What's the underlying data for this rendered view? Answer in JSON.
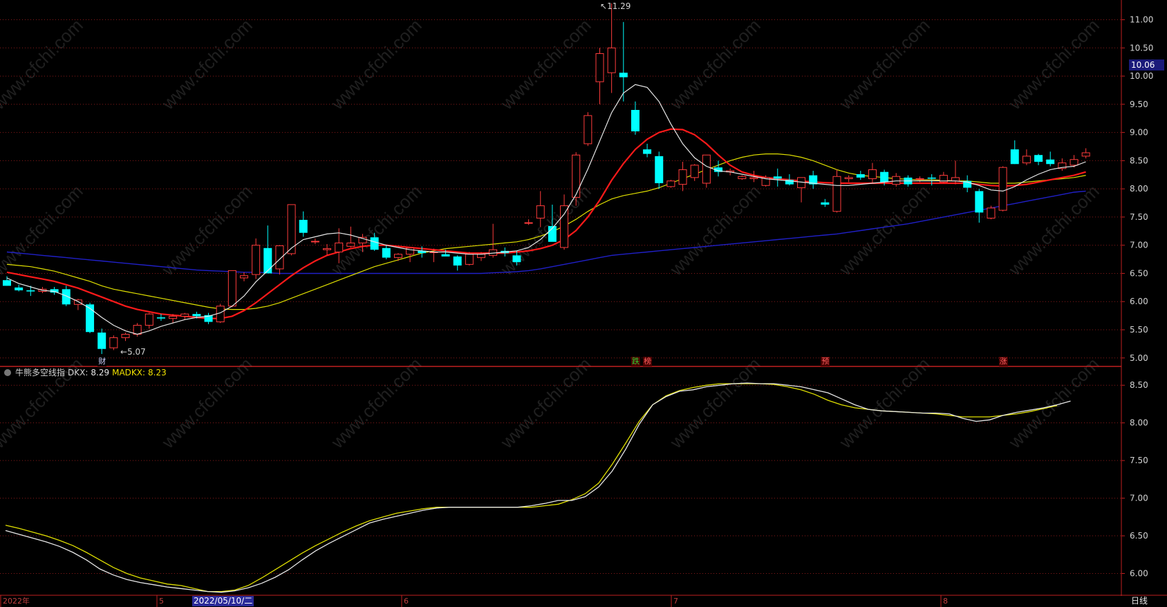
{
  "chart_data": {
    "type": "candlestick",
    "upper_panel": {
      "y_ticks": [
        "11.00",
        "10.50",
        "10.00",
        "9.50",
        "9.00",
        "8.50",
        "8.00",
        "7.50",
        "7.00",
        "6.50",
        "6.00",
        "5.50",
        "5.00"
      ],
      "ylim": [
        4.85,
        11.35
      ],
      "current_price": "10.06",
      "high_mark": "11.29",
      "low_mark": "5.07",
      "candles": [
        {
          "o": 6.38,
          "h": 6.45,
          "l": 6.28,
          "c": 6.28
        },
        {
          "o": 6.25,
          "h": 6.3,
          "l": 6.18,
          "c": 6.2
        },
        {
          "o": 6.2,
          "h": 6.28,
          "l": 6.1,
          "c": 6.18
        },
        {
          "o": 6.18,
          "h": 6.26,
          "l": 6.15,
          "c": 6.22
        },
        {
          "o": 6.22,
          "h": 6.26,
          "l": 6.12,
          "c": 6.16
        },
        {
          "o": 6.22,
          "h": 6.28,
          "l": 5.92,
          "c": 5.95
        },
        {
          "o": 5.95,
          "h": 6.05,
          "l": 5.85,
          "c": 6.03
        },
        {
          "o": 5.95,
          "h": 5.98,
          "l": 5.44,
          "c": 5.46
        },
        {
          "o": 5.45,
          "h": 5.52,
          "l": 5.07,
          "c": 5.16
        },
        {
          "o": 5.18,
          "h": 5.4,
          "l": 5.14,
          "c": 5.36
        },
        {
          "o": 5.36,
          "h": 5.45,
          "l": 5.3,
          "c": 5.42
        },
        {
          "o": 5.42,
          "h": 5.62,
          "l": 5.38,
          "c": 5.58
        },
        {
          "o": 5.58,
          "h": 5.8,
          "l": 5.52,
          "c": 5.78
        },
        {
          "o": 5.72,
          "h": 5.78,
          "l": 5.66,
          "c": 5.7
        },
        {
          "o": 5.7,
          "h": 5.78,
          "l": 5.62,
          "c": 5.74
        },
        {
          "o": 5.74,
          "h": 5.8,
          "l": 5.68,
          "c": 5.78
        },
        {
          "o": 5.78,
          "h": 5.82,
          "l": 5.7,
          "c": 5.74
        },
        {
          "o": 5.76,
          "h": 5.8,
          "l": 5.6,
          "c": 5.64
        },
        {
          "o": 5.64,
          "h": 5.96,
          "l": 5.62,
          "c": 5.92
        },
        {
          "o": 5.92,
          "h": 6.55,
          "l": 5.9,
          "c": 6.55
        },
        {
          "o": 6.42,
          "h": 6.52,
          "l": 6.36,
          "c": 6.46
        },
        {
          "o": 6.48,
          "h": 7.12,
          "l": 6.4,
          "c": 7.0
        },
        {
          "o": 6.95,
          "h": 7.35,
          "l": 6.75,
          "c": 6.5
        },
        {
          "o": 6.58,
          "h": 7.0,
          "l": 6.48,
          "c": 6.99
        },
        {
          "o": 6.85,
          "h": 7.72,
          "l": 6.82,
          "c": 7.72
        },
        {
          "o": 7.45,
          "h": 7.6,
          "l": 7.15,
          "c": 7.22
        },
        {
          "o": 7.07,
          "h": 7.12,
          "l": 7.02,
          "c": 7.07
        },
        {
          "o": 6.92,
          "h": 7.02,
          "l": 6.82,
          "c": 6.94
        },
        {
          "o": 6.88,
          "h": 7.3,
          "l": 6.68,
          "c": 7.04
        },
        {
          "o": 6.98,
          "h": 7.33,
          "l": 6.96,
          "c": 7.04
        },
        {
          "o": 7.04,
          "h": 7.2,
          "l": 6.88,
          "c": 7.14
        },
        {
          "o": 7.14,
          "h": 7.22,
          "l": 6.9,
          "c": 6.92
        },
        {
          "o": 6.95,
          "h": 7.0,
          "l": 6.75,
          "c": 6.78
        },
        {
          "o": 6.78,
          "h": 6.86,
          "l": 6.72,
          "c": 6.84
        },
        {
          "o": 6.84,
          "h": 6.95,
          "l": 6.7,
          "c": 6.95
        },
        {
          "o": 6.9,
          "h": 6.98,
          "l": 6.78,
          "c": 6.86
        },
        {
          "o": 6.88,
          "h": 6.94,
          "l": 6.7,
          "c": 6.88
        },
        {
          "o": 6.84,
          "h": 6.92,
          "l": 6.8,
          "c": 6.8
        },
        {
          "o": 6.8,
          "h": 6.82,
          "l": 6.55,
          "c": 6.64
        },
        {
          "o": 6.66,
          "h": 6.88,
          "l": 6.64,
          "c": 6.84
        },
        {
          "o": 6.78,
          "h": 6.88,
          "l": 6.72,
          "c": 6.84
        },
        {
          "o": 6.82,
          "h": 7.38,
          "l": 6.78,
          "c": 6.92
        },
        {
          "o": 6.9,
          "h": 6.96,
          "l": 6.8,
          "c": 6.86
        },
        {
          "o": 6.82,
          "h": 6.9,
          "l": 6.64,
          "c": 6.7
        },
        {
          "o": 7.4,
          "h": 7.46,
          "l": 7.36,
          "c": 7.4
        },
        {
          "o": 7.48,
          "h": 7.96,
          "l": 7.32,
          "c": 7.7
        },
        {
          "o": 7.34,
          "h": 7.72,
          "l": 7.2,
          "c": 7.06
        },
        {
          "o": 6.96,
          "h": 7.9,
          "l": 6.92,
          "c": 7.7
        },
        {
          "o": 7.85,
          "h": 8.65,
          "l": 7.7,
          "c": 8.6
        },
        {
          "o": 8.8,
          "h": 9.36,
          "l": 8.76,
          "c": 9.3
        },
        {
          "o": 9.9,
          "h": 10.5,
          "l": 9.5,
          "c": 10.4
        },
        {
          "o": 10.06,
          "h": 11.29,
          "l": 9.7,
          "c": 10.5
        },
        {
          "o": 10.06,
          "h": 10.96,
          "l": 9.55,
          "c": 9.98
        },
        {
          "o": 9.4,
          "h": 9.55,
          "l": 8.96,
          "c": 9.02
        },
        {
          "o": 8.7,
          "h": 8.8,
          "l": 8.56,
          "c": 8.62
        },
        {
          "o": 8.58,
          "h": 8.66,
          "l": 8.0,
          "c": 8.1
        },
        {
          "o": 8.04,
          "h": 8.16,
          "l": 8.02,
          "c": 8.14
        },
        {
          "o": 8.08,
          "h": 8.48,
          "l": 7.96,
          "c": 8.34
        },
        {
          "o": 8.2,
          "h": 8.44,
          "l": 8.14,
          "c": 8.42
        },
        {
          "o": 8.1,
          "h": 8.6,
          "l": 8.02,
          "c": 8.6
        },
        {
          "o": 8.38,
          "h": 8.5,
          "l": 8.22,
          "c": 8.3
        },
        {
          "o": 8.3,
          "h": 8.36,
          "l": 8.24,
          "c": 8.32
        },
        {
          "o": 8.18,
          "h": 8.24,
          "l": 8.16,
          "c": 8.22
        },
        {
          "o": 8.18,
          "h": 8.32,
          "l": 8.12,
          "c": 8.2
        },
        {
          "o": 8.06,
          "h": 8.24,
          "l": 8.04,
          "c": 8.2
        },
        {
          "o": 8.22,
          "h": 8.36,
          "l": 8.04,
          "c": 8.18
        },
        {
          "o": 8.16,
          "h": 8.26,
          "l": 8.06,
          "c": 8.08
        },
        {
          "o": 8.02,
          "h": 8.2,
          "l": 7.76,
          "c": 8.2
        },
        {
          "o": 8.24,
          "h": 8.32,
          "l": 8.0,
          "c": 8.08
        },
        {
          "o": 7.76,
          "h": 7.82,
          "l": 7.68,
          "c": 7.72
        },
        {
          "o": 7.6,
          "h": 8.34,
          "l": 7.58,
          "c": 8.22
        },
        {
          "o": 8.18,
          "h": 8.24,
          "l": 8.12,
          "c": 8.2
        },
        {
          "o": 8.26,
          "h": 8.32,
          "l": 8.16,
          "c": 8.2
        },
        {
          "o": 8.18,
          "h": 8.46,
          "l": 8.1,
          "c": 8.34
        },
        {
          "o": 8.3,
          "h": 8.34,
          "l": 8.06,
          "c": 8.12
        },
        {
          "o": 8.08,
          "h": 8.28,
          "l": 8.04,
          "c": 8.22
        },
        {
          "o": 8.2,
          "h": 8.24,
          "l": 8.04,
          "c": 8.08
        },
        {
          "o": 8.18,
          "h": 8.22,
          "l": 8.12,
          "c": 8.18
        },
        {
          "o": 8.2,
          "h": 8.26,
          "l": 8.06,
          "c": 8.18
        },
        {
          "o": 8.12,
          "h": 8.3,
          "l": 8.1,
          "c": 8.24
        },
        {
          "o": 8.14,
          "h": 8.5,
          "l": 8.08,
          "c": 8.2
        },
        {
          "o": 8.14,
          "h": 8.24,
          "l": 7.94,
          "c": 8.02
        },
        {
          "o": 7.96,
          "h": 8.0,
          "l": 7.4,
          "c": 7.58
        },
        {
          "o": 7.48,
          "h": 7.7,
          "l": 7.46,
          "c": 7.66
        },
        {
          "o": 7.62,
          "h": 8.4,
          "l": 7.6,
          "c": 8.38
        },
        {
          "o": 8.7,
          "h": 8.86,
          "l": 8.44,
          "c": 8.44
        },
        {
          "o": 8.46,
          "h": 8.7,
          "l": 8.42,
          "c": 8.58
        },
        {
          "o": 8.6,
          "h": 8.62,
          "l": 8.42,
          "c": 8.48
        },
        {
          "o": 8.52,
          "h": 8.66,
          "l": 8.4,
          "c": 8.44
        },
        {
          "o": 8.36,
          "h": 8.54,
          "l": 8.32,
          "c": 8.46
        },
        {
          "o": 8.42,
          "h": 8.6,
          "l": 8.38,
          "c": 8.52
        },
        {
          "o": 8.58,
          "h": 8.72,
          "l": 8.54,
          "c": 8.64
        }
      ],
      "ma_white": [
        6.42,
        6.32,
        6.26,
        6.2,
        6.18,
        6.1,
        6.0,
        5.88,
        5.72,
        5.58,
        5.48,
        5.42,
        5.48,
        5.56,
        5.62,
        5.68,
        5.72,
        5.74,
        5.8,
        5.92,
        6.1,
        6.35,
        6.55,
        6.75,
        6.95,
        7.1,
        7.15,
        7.2,
        7.22,
        7.18,
        7.12,
        7.06,
        7.0,
        6.96,
        6.92,
        6.9,
        6.88,
        6.88,
        6.86,
        6.84,
        6.84,
        6.86,
        6.88,
        6.9,
        6.96,
        7.1,
        7.3,
        7.55,
        7.9,
        8.35,
        8.85,
        9.35,
        9.7,
        9.85,
        9.8,
        9.55,
        9.15,
        8.8,
        8.55,
        8.4,
        8.32,
        8.3,
        8.26,
        8.22,
        8.18,
        8.16,
        8.14,
        8.12,
        8.1,
        8.08,
        8.06,
        8.06,
        8.08,
        8.1,
        8.12,
        8.14,
        8.14,
        8.14,
        8.14,
        8.14,
        8.14,
        8.12,
        8.06,
        7.98,
        7.96,
        8.04,
        8.16,
        8.26,
        8.34,
        8.38,
        8.4,
        8.48
      ],
      "ma_red": [
        6.52,
        6.48,
        6.44,
        6.4,
        6.36,
        6.3,
        6.24,
        6.16,
        6.08,
        6.0,
        5.92,
        5.86,
        5.82,
        5.78,
        5.76,
        5.74,
        5.72,
        5.7,
        5.7,
        5.74,
        5.84,
        5.98,
        6.14,
        6.3,
        6.46,
        6.6,
        6.72,
        6.82,
        6.88,
        6.94,
        6.98,
        7.0,
        7.0,
        6.98,
        6.96,
        6.94,
        6.92,
        6.9,
        6.88,
        6.86,
        6.86,
        6.86,
        6.86,
        6.88,
        6.9,
        6.94,
        7.0,
        7.1,
        7.26,
        7.5,
        7.8,
        8.15,
        8.45,
        8.7,
        8.88,
        9.0,
        9.06,
        9.05,
        8.96,
        8.8,
        8.6,
        8.42,
        8.3,
        8.24,
        8.2,
        8.18,
        8.16,
        8.14,
        8.12,
        8.11,
        8.1,
        8.1,
        8.1,
        8.1,
        8.1,
        8.1,
        8.1,
        8.1,
        8.1,
        8.1,
        8.1,
        8.1,
        8.08,
        8.06,
        8.05,
        8.06,
        8.08,
        8.12,
        8.16,
        8.2,
        8.24,
        8.3
      ],
      "ma_yellow": [
        6.66,
        6.64,
        6.62,
        6.58,
        6.54,
        6.48,
        6.42,
        6.36,
        6.28,
        6.22,
        6.18,
        6.14,
        6.1,
        6.06,
        6.02,
        5.98,
        5.94,
        5.9,
        5.87,
        5.86,
        5.86,
        5.88,
        5.92,
        5.98,
        6.06,
        6.14,
        6.22,
        6.3,
        6.38,
        6.46,
        6.54,
        6.62,
        6.68,
        6.74,
        6.8,
        6.86,
        6.9,
        6.94,
        6.96,
        6.98,
        7.0,
        7.02,
        7.04,
        7.06,
        7.1,
        7.16,
        7.24,
        7.34,
        7.46,
        7.6,
        7.72,
        7.82,
        7.88,
        7.92,
        7.96,
        8.02,
        8.1,
        8.18,
        8.26,
        8.34,
        8.42,
        8.5,
        8.56,
        8.6,
        8.62,
        8.62,
        8.6,
        8.56,
        8.5,
        8.42,
        8.34,
        8.28,
        8.24,
        8.22,
        8.2,
        8.18,
        8.17,
        8.16,
        8.16,
        8.15,
        8.14,
        8.14,
        8.12,
        8.1,
        8.1,
        8.1,
        8.12,
        8.14,
        8.16,
        8.18,
        8.2,
        8.24
      ],
      "ma_blue": [
        6.88,
        6.86,
        6.84,
        6.82,
        6.8,
        6.78,
        6.76,
        6.74,
        6.72,
        6.7,
        6.68,
        6.66,
        6.64,
        6.62,
        6.6,
        6.58,
        6.56,
        6.55,
        6.54,
        6.53,
        6.52,
        6.52,
        6.51,
        6.5,
        6.5,
        6.5,
        6.5,
        6.5,
        6.5,
        6.5,
        6.5,
        6.5,
        6.5,
        6.5,
        6.5,
        6.5,
        6.5,
        6.5,
        6.5,
        6.5,
        6.5,
        6.51,
        6.52,
        6.53,
        6.55,
        6.58,
        6.62,
        6.66,
        6.7,
        6.74,
        6.78,
        6.82,
        6.84,
        6.86,
        6.88,
        6.9,
        6.92,
        6.94,
        6.96,
        6.98,
        7.0,
        7.02,
        7.04,
        7.06,
        7.08,
        7.1,
        7.12,
        7.14,
        7.16,
        7.18,
        7.2,
        7.23,
        7.26,
        7.29,
        7.32,
        7.35,
        7.38,
        7.42,
        7.46,
        7.5,
        7.54,
        7.58,
        7.62,
        7.66,
        7.7,
        7.74,
        7.78,
        7.82,
        7.86,
        7.9,
        7.94,
        7.96
      ]
    },
    "lower_panel": {
      "indicator_name": "牛熊多空线指",
      "dkx_label": "DKX:",
      "dkx_value": "8.29",
      "madkx_label": "MADKX:",
      "madkx_value": "8.23",
      "y_ticks": [
        "8.50",
        "8.00",
        "7.50",
        "7.00",
        "6.50",
        "6.00"
      ],
      "ylim": [
        5.72,
        8.75
      ],
      "dkx": [
        6.57,
        6.52,
        6.47,
        6.42,
        6.36,
        6.28,
        6.18,
        6.06,
        5.98,
        5.92,
        5.88,
        5.85,
        5.82,
        5.8,
        5.78,
        5.76,
        5.75,
        5.77,
        5.81,
        5.87,
        5.95,
        6.05,
        6.18,
        6.3,
        6.4,
        6.49,
        6.58,
        6.67,
        6.72,
        6.76,
        6.8,
        6.84,
        6.87,
        6.88,
        6.88,
        6.88,
        6.88,
        6.88,
        6.88,
        6.9,
        6.93,
        6.97,
        6.97,
        7.02,
        7.15,
        7.36,
        7.65,
        7.98,
        8.24,
        8.35,
        8.42,
        8.44,
        8.48,
        8.5,
        8.52,
        8.53,
        8.52,
        8.52,
        8.5,
        8.48,
        8.44,
        8.4,
        8.32,
        8.24,
        8.18,
        8.16,
        8.15,
        8.14,
        8.13,
        8.13,
        8.12,
        8.06,
        8.02,
        8.04,
        8.1,
        8.14,
        8.17,
        8.2,
        8.24,
        8.29
      ],
      "madkx": [
        6.64,
        6.6,
        6.55,
        6.5,
        6.44,
        6.37,
        6.28,
        6.18,
        6.08,
        6.0,
        5.94,
        5.9,
        5.86,
        5.84,
        5.8,
        5.76,
        5.76,
        5.78,
        5.84,
        5.94,
        6.05,
        6.16,
        6.27,
        6.37,
        6.46,
        6.55,
        6.63,
        6.7,
        6.75,
        6.8,
        6.83,
        6.86,
        6.88,
        6.88,
        6.88,
        6.88,
        6.88,
        6.88,
        6.88,
        6.88,
        6.9,
        6.92,
        6.98,
        7.06,
        7.2,
        7.45,
        7.73,
        8.02,
        8.24,
        8.36,
        8.43,
        8.47,
        8.5,
        8.52,
        8.52,
        8.52,
        8.52,
        8.51,
        8.48,
        8.44,
        8.38,
        8.3,
        8.24,
        8.2,
        8.18,
        8.16,
        8.15,
        8.14,
        8.13,
        8.12,
        8.1,
        8.08,
        8.08,
        8.08,
        8.1,
        8.12,
        8.15,
        8.19,
        8.23
      ]
    },
    "x_axis": {
      "labels": [
        "2022年",
        "5",
        "6",
        "7",
        "8"
      ],
      "active_date": "2022/05/10/二"
    },
    "badges": [
      {
        "text": "财",
        "color": "#d0d0ff",
        "bg": "#000000",
        "candle": 8
      },
      {
        "text": "跌",
        "color": "#30d030",
        "bg": "#4a0000",
        "candle": 53
      },
      {
        "text": "榜",
        "color": "#ff6060",
        "bg": "#4a0000",
        "candle": 54
      },
      {
        "text": "预",
        "color": "#ff6060",
        "bg": "#4a0000",
        "candle": 69
      },
      {
        "text": "涨",
        "color": "#ff6060",
        "bg": "#4a0000",
        "candle": 84
      }
    ],
    "period": "日线",
    "watermark": "www.cfchi.com",
    "colors": {
      "up": "#ff3c3c",
      "down": "#00ffff",
      "ma_white": "#e8e8e8",
      "ma_red": "#ff1a1a",
      "ma_yellow": "#e0e000",
      "ma_blue": "#2020c8",
      "grid": "#8a1a1a",
      "axis": "#c02020"
    }
  }
}
